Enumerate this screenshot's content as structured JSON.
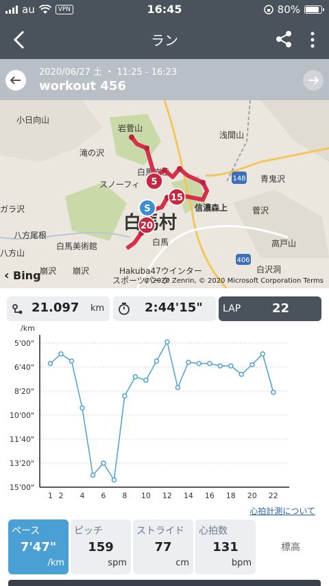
{
  "status": {
    "carrier": "au",
    "vpn": "VPN",
    "time": "16:45",
    "battery": "80%"
  },
  "nav": {
    "title": "ラン"
  },
  "workout": {
    "datetime": "2020/06/27 土 ・ 11:25 - 16:23",
    "name": "workout 456"
  },
  "map": {
    "labels": [
      "小日向山",
      "岩菅山",
      "浅間山",
      "滝の沢",
      "白馬岩岳",
      "スノーフィ",
      "青鬼沢",
      "ガラ沢",
      "八方尾根",
      "信濃森上",
      "菅沢",
      "白馬美術館",
      "白馬",
      "高戸山",
      "八方山",
      "崩沢",
      "崩沢",
      "Hakuba47ウインター",
      "スポーツパーク",
      "白沢洞",
      "白馬村",
      "148",
      "406"
    ],
    "markers": [
      "S",
      "5",
      "15",
      "20"
    ],
    "attribution": "Bing",
    "copyright": "© 2020 Zenrin, © 2020 Microsoft Corporation  Terms"
  },
  "summary": {
    "distance": "21.097",
    "distance_unit": "km",
    "duration": "2:44'15\"",
    "lap_label": "LAP",
    "lap_value": "22"
  },
  "chart_data": {
    "type": "line",
    "ylabel": "/km",
    "y_ticks": [
      "5'00\"",
      "6'40\"",
      "8'20\"",
      "10'00\"",
      "11'40\"",
      "13'20\"",
      "15'00\""
    ],
    "y_tick_seconds": [
      300,
      400,
      500,
      600,
      700,
      800,
      900
    ],
    "ylim_seconds": [
      300,
      900
    ],
    "y_inverted": true,
    "x_ticks": [
      "1",
      "2",
      "4",
      "6",
      "8",
      "10",
      "12",
      "14",
      "16",
      "18",
      "20",
      "22"
    ],
    "x": [
      1,
      2,
      3,
      4,
      5,
      6,
      7,
      8,
      9,
      10,
      11,
      12,
      13,
      14,
      15,
      16,
      17,
      18,
      19,
      20,
      21,
      22
    ],
    "values_seconds": [
      385,
      345,
      375,
      570,
      850,
      800,
      870,
      520,
      440,
      455,
      375,
      295,
      485,
      380,
      385,
      385,
      395,
      395,
      430,
      390,
      345,
      505
    ],
    "color": "#4aa0d5",
    "grid": true
  },
  "hr_link": "心拍計測について",
  "metrics": [
    {
      "label": "ペース",
      "value": "7'47\"",
      "unit": "/km"
    },
    {
      "label": "ピッチ",
      "value": "159",
      "unit": "spm"
    },
    {
      "label": "ストライド",
      "value": "77",
      "unit": "cm"
    },
    {
      "label": "心拍数",
      "value": "131",
      "unit": "bpm"
    }
  ],
  "altitude_label": "標高",
  "colors": {
    "bar": "#4a525c",
    "accent": "#4aa0d5",
    "route": "#d62f4b"
  }
}
